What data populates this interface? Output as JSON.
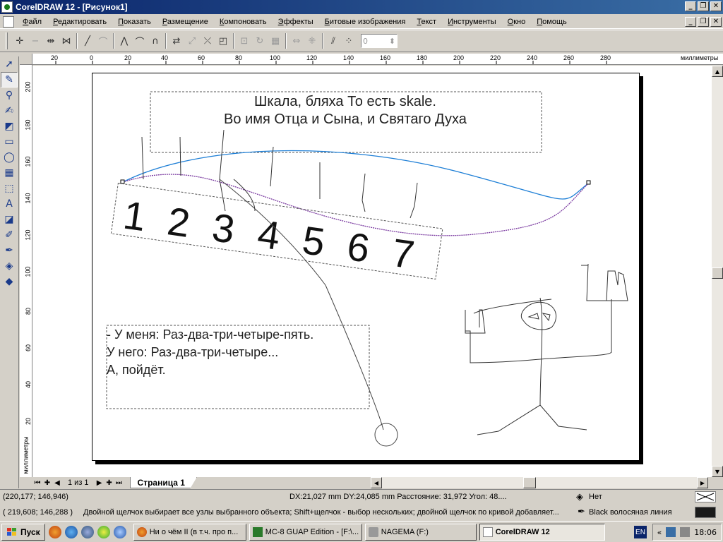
{
  "window": {
    "title": "CorelDRAW 12 - [Рисунок1]",
    "minimize": "_",
    "restore": "❐",
    "close": "✕"
  },
  "menu": {
    "items": [
      "Файл",
      "Редактировать",
      "Показать",
      "Размещение",
      "Компоновать",
      "Эффекты",
      "Битовые изображения",
      "Текст",
      "Инструменты",
      "Окно",
      "Помощь"
    ]
  },
  "toolbar": {
    "spin_value": "0"
  },
  "ruler": {
    "unit": "миллиметры",
    "top_ticks": [
      "20",
      "0",
      "20",
      "40",
      "60",
      "80",
      "100",
      "120",
      "140",
      "160",
      "180",
      "200",
      "220",
      "240",
      "260",
      "280"
    ],
    "left_ticks": [
      "200",
      "180",
      "160",
      "140",
      "120",
      "100",
      "80",
      "60",
      "40",
      "20"
    ]
  },
  "drawing": {
    "header_line1": "Шкала, бляха То есть skale.",
    "header_line2": "Во  имя Отца и Сына, и Святаго Духа",
    "digits": [
      "1",
      "2",
      "3",
      "4",
      "5",
      "6",
      "7"
    ],
    "body_line1": "- У меня: Раз-два-три-четыре-пять.",
    "body_line2": "У него: Раз-два-три-четыре...",
    "body_line3": "А, пойдёт."
  },
  "pages": {
    "counter": "1 из 1",
    "tab_label": "Страница 1"
  },
  "status": {
    "coords1": "(220,177; 146,946)",
    "measure": "DX:21,027 mm DY:24,085 mm Расстояние: 31,972 Угол: 48....",
    "fill_label": "Нет",
    "coords2": "( 219,608; 146,288 )",
    "hint": "Двойной щелчок выбирает все узлы выбранного объекта; Shift+щелчок - выбор нескольких; двойной щелчок по кривой добавляет...",
    "outline_label": "Black  волосяная линия"
  },
  "taskbar": {
    "start": "Пуск",
    "tasks": [
      "Ни о чём II (в т.ч. про п...",
      "MC-8 GUAP Edition - [F:\\...",
      "NAGEMA (F:)",
      "CorelDRAW 12"
    ],
    "lang": "EN",
    "clock": "18:06",
    "tray_chevron": "«"
  },
  "colors": {
    "title_gradient_start": "#0a246a",
    "title_gradient_end": "#3a6ea5",
    "curve_blue": "#1e7fd6",
    "curve_dotted": "#7a3aa0",
    "outline_swatch": "#000000"
  }
}
